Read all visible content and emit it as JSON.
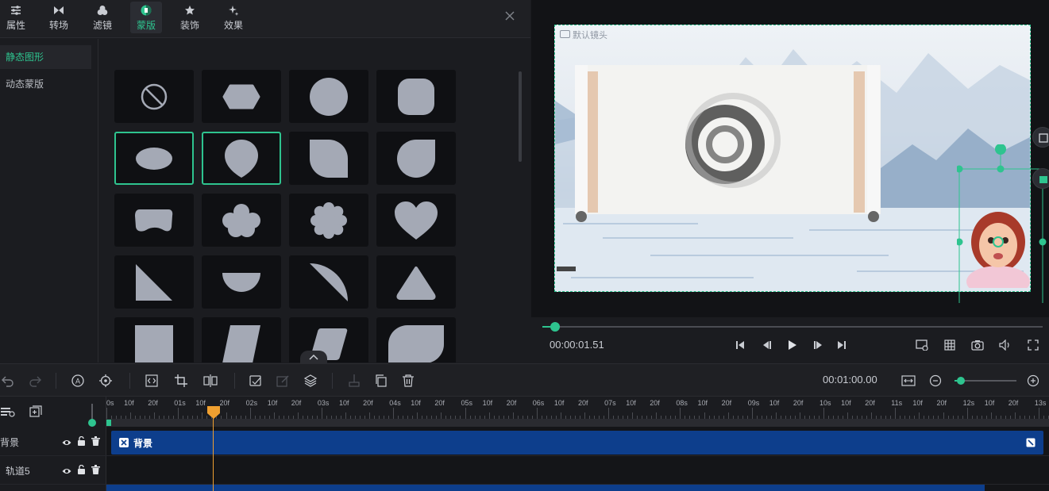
{
  "tabs": [
    {
      "label": "属性",
      "icon": "sliders-icon"
    },
    {
      "label": "转场",
      "icon": "transition-icon"
    },
    {
      "label": "滤镜",
      "icon": "filter-icon"
    },
    {
      "label": "蒙版",
      "icon": "mask-icon",
      "active": true
    },
    {
      "label": "装饰",
      "icon": "decoration-icon"
    },
    {
      "label": "效果",
      "icon": "effect-icon"
    }
  ],
  "categories": [
    {
      "label": "静态图形",
      "active": true
    },
    {
      "label": "动态蒙版",
      "active": false
    }
  ],
  "shapes": [
    "none",
    "hexagon",
    "circle",
    "rounded-square",
    "ellipse",
    "drop",
    "leaf-square",
    "leaf-round",
    "blob",
    "cloud",
    "flower",
    "heart",
    "triangle-right",
    "half-circle",
    "slice",
    "triangle-round",
    "square",
    "parallelogram",
    "parallelogram-round",
    "rounded-leaf"
  ],
  "preview": {
    "camera_label": "默认镜头"
  },
  "playback": {
    "current_time": "00:00:01.51",
    "progress": 0.02
  },
  "toolbar": {
    "total_time": "00:01:00.00"
  },
  "timeline": {
    "ruler_labels": [
      "0s",
      "10f",
      "20f",
      "01s",
      "10f",
      "20f",
      "02s",
      "10f",
      "20f",
      "03s",
      "10f",
      "20f",
      "04s",
      "10f",
      "20f",
      "05s",
      "10f",
      "20f",
      "06s",
      "10f",
      "20f",
      "07s",
      "10f",
      "20f",
      "08s",
      "10f",
      "20f",
      "09s",
      "10f",
      "20f",
      "10s",
      "10f",
      "20f",
      "11s",
      "10f",
      "20f",
      "12s",
      "10f",
      "20f",
      "13s"
    ],
    "tracks": [
      {
        "name": "背景",
        "clip_label": "背景"
      },
      {
        "name": "轨道5"
      }
    ]
  },
  "colors": {
    "accent": "#2ec48f",
    "clip": "#0d3e8c",
    "playhead": "#f0a030"
  }
}
